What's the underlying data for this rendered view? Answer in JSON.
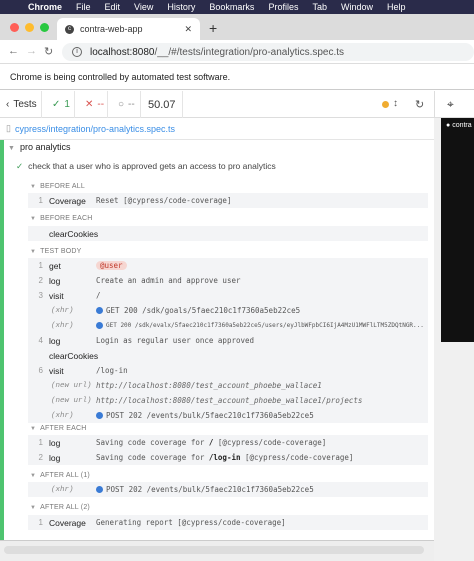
{
  "menubar": {
    "items": [
      "Chrome",
      "File",
      "Edit",
      "View",
      "History",
      "Bookmarks",
      "Profiles",
      "Tab",
      "Window",
      "Help"
    ]
  },
  "browser": {
    "tab_title": "contra-web-app",
    "new_tab": "+",
    "url_host": "localhost:8080",
    "url_path": "/__/#/tests/integration/pro-analytics.spec.ts",
    "infobar": "Chrome is being controlled by automated test software."
  },
  "reporter": {
    "tests_label": "Tests",
    "passed": "1",
    "failed": "--",
    "pending": "--",
    "duration": "50.07",
    "spec_path": "cypress/integration/pro-analytics.spec.ts",
    "suite": "pro analytics",
    "test": "check that a user who is approved gets an access to pro analytics"
  },
  "preview": {
    "logo": "contra"
  },
  "hooks": {
    "before_all": "BEFORE ALL",
    "before_each": "BEFORE EACH",
    "test_body": "TEST BODY",
    "after_each": "AFTER EACH",
    "after_all_1": "AFTER ALL (1)",
    "after_all_2": "AFTER ALL (2)"
  },
  "commands": {
    "ba": {
      "num": "1",
      "name": "Coverage",
      "msg": "Reset [@cypress/code-coverage]"
    },
    "be": {
      "num": "",
      "name": "clearCookies",
      "msg": ""
    },
    "tb": [
      {
        "num": "1",
        "name": "get",
        "msg": "@user"
      },
      {
        "num": "2",
        "name": "log",
        "msg": "Create an admin and approve user"
      },
      {
        "num": "3",
        "name": "visit",
        "msg": "/"
      },
      {
        "num": "",
        "name": "(xhr)",
        "msg": "GET 200 /sdk/goals/5faec210c1f7360a5eb22ce5"
      },
      {
        "num": "",
        "name": "(xhr)",
        "msg": "GET 200 /sdk/evalx/5faec210c1f7360a5eb22ce5/users/eyJlbWFpbCI6IjA4MzU1MWFlLTM5ZDQtNGR..."
      },
      {
        "num": "4",
        "name": "log",
        "msg": "Login as regular user once approved"
      },
      {
        "num": "",
        "name": "clearCookies",
        "msg": ""
      },
      {
        "num": "6",
        "name": "visit",
        "msg": "/log-in"
      },
      {
        "num": "",
        "name": "(new url)",
        "msg": "http://localhost:8080/test_account_phoebe_wallace1"
      },
      {
        "num": "",
        "name": "(new url)",
        "msg": "http://localhost:8080/test_account_phoebe_wallace1/projects"
      },
      {
        "num": "",
        "name": "(xhr)",
        "msg": "POST 202 /events/bulk/5faec210c1f7360a5eb22ce5"
      }
    ],
    "ae": [
      {
        "num": "1",
        "name": "log",
        "msg_pre": "Saving code coverage for ",
        "msg_bold": "/",
        "msg_post": " [@cypress/code-coverage]"
      },
      {
        "num": "2",
        "name": "log",
        "msg_pre": "Saving code coverage for ",
        "msg_bold": "/log-in",
        "msg_post": " [@cypress/code-coverage]"
      }
    ],
    "aa1": {
      "num": "",
      "name": "(xhr)",
      "msg": "POST 202 /events/bulk/5faec210c1f7360a5eb22ce5"
    },
    "aa2": {
      "num": "1",
      "name": "Coverage",
      "msg": "Generating report [@cypress/code-coverage]"
    }
  },
  "colors": {
    "pass": "#3a9a54",
    "fail": "#d9534f",
    "running": "#f0ac30",
    "link": "#3a8ee6",
    "test_bar": "#4ec46f"
  }
}
